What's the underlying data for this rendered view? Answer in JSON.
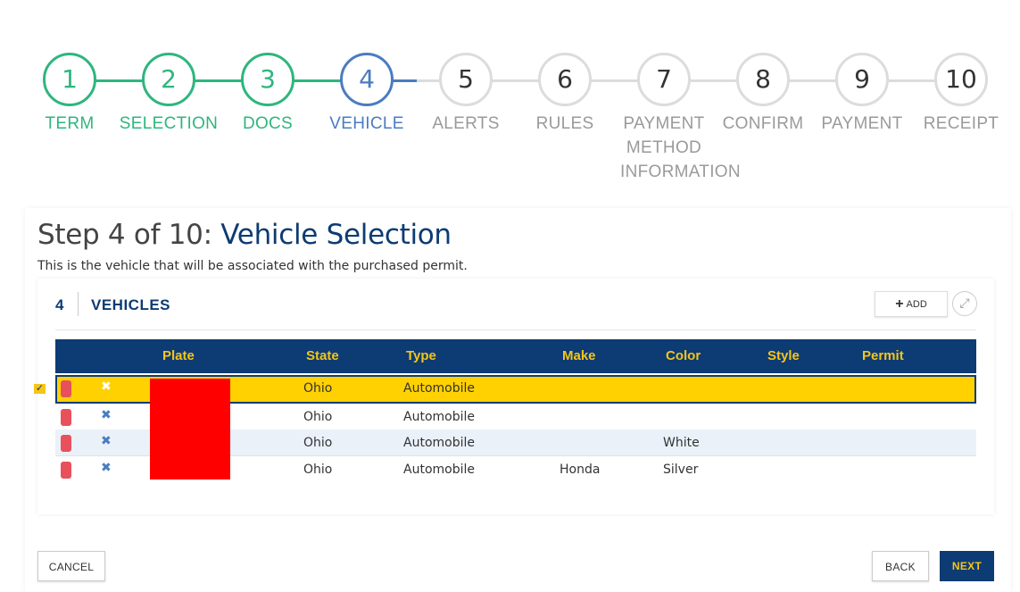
{
  "stepper": {
    "steps": [
      {
        "number": "1",
        "label": "TERM",
        "status": "done"
      },
      {
        "number": "2",
        "label": "SELECTION",
        "status": "done"
      },
      {
        "number": "3",
        "label": "DOCS",
        "status": "done"
      },
      {
        "number": "4",
        "label": "VEHICLE",
        "status": "active"
      },
      {
        "number": "5",
        "label": "ALERTS",
        "status": "pending"
      },
      {
        "number": "6",
        "label": "RULES",
        "status": "pending"
      },
      {
        "number": "7",
        "label_lines": [
          "PAYMENT",
          "METHOD",
          "INFORMATION"
        ],
        "status": "pending"
      },
      {
        "number": "8",
        "label": "CONFIRM",
        "status": "pending"
      },
      {
        "number": "9",
        "label": "PAYMENT",
        "status": "pending"
      },
      {
        "number": "10",
        "label": "RECEIPT",
        "status": "pending"
      }
    ]
  },
  "page": {
    "title_prefix": "Step 4 of 10: ",
    "title_main": "Vehicle Selection",
    "subtitle": "This is the vehicle that will be associated with the purchased permit."
  },
  "vehicles": {
    "count": "4",
    "heading": "VEHICLES",
    "add_label": "ADD",
    "expand_icon": "expand-icon",
    "columns": [
      "Plate",
      "State",
      "Type",
      "Make",
      "Color",
      "Style",
      "Permit"
    ],
    "rows": [
      {
        "plate": "",
        "state": "Ohio",
        "type": "Automobile",
        "make": "",
        "color": "",
        "style": "",
        "permit": "",
        "selected": true
      },
      {
        "plate": "",
        "state": "Ohio",
        "type": "Automobile",
        "make": "",
        "color": "",
        "style": "",
        "permit": "",
        "selected": false
      },
      {
        "plate": "",
        "state": "Ohio",
        "type": "Automobile",
        "make": "",
        "color": "White",
        "style": "",
        "permit": "",
        "selected": false
      },
      {
        "plate": "",
        "state": "Ohio",
        "type": "Automobile",
        "make": "Honda",
        "color": "Silver",
        "style": "",
        "permit": "",
        "selected": false
      }
    ]
  },
  "footer": {
    "cancel_label": "CANCEL",
    "back_label": "BACK",
    "next_label": "NEXT"
  },
  "colors": {
    "done": "#2eb67d",
    "active": "#4a7cc0",
    "pending": "#dcdcdc",
    "navy": "#0d3b73",
    "gold": "#f5c518",
    "selected_row": "#ffd100",
    "delete": "#e8505b"
  }
}
